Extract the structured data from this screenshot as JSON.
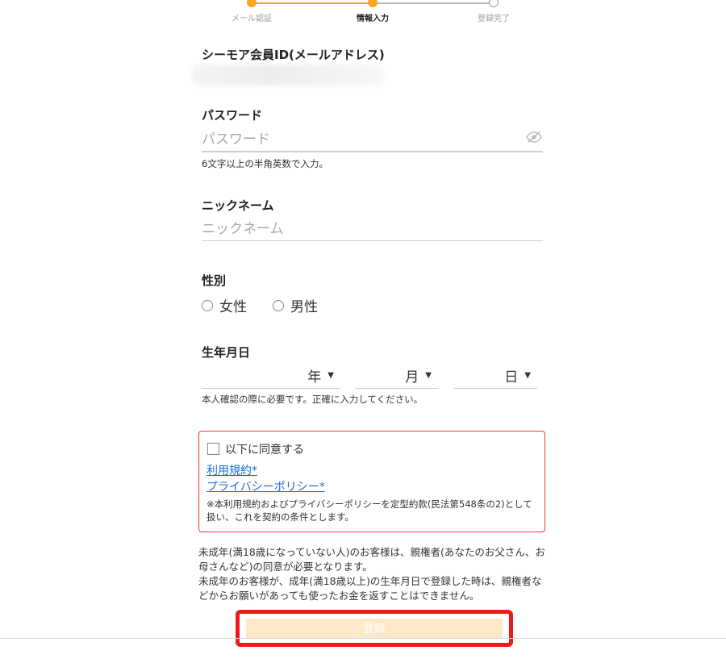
{
  "stepper": {
    "steps": [
      {
        "label": "メール認証"
      },
      {
        "label": "情報入力"
      },
      {
        "label": "登録完了"
      }
    ],
    "accent_color": "#f5a623"
  },
  "email": {
    "title": "シーモア会員ID(メールアドレス)"
  },
  "password": {
    "title": "パスワード",
    "placeholder": "パスワード",
    "value": "",
    "hint": "6文字以上の半角英数で入力。",
    "toggle_icon": "eye-off-icon"
  },
  "nickname": {
    "title": "ニックネーム",
    "placeholder": "ニックネーム",
    "value": ""
  },
  "gender": {
    "title": "性別",
    "options": [
      "女性",
      "男性"
    ]
  },
  "birthdate": {
    "title": "生年月日",
    "year_label": "年",
    "month_label": "月",
    "day_label": "日",
    "hint": "本人確認の際に必要です。正確に入力してください。"
  },
  "agreement": {
    "label": "以下に同意する",
    "terms_link": "利用規約*",
    "privacy_link": "プライバシーポリシー*",
    "note": "※本利用規約およびプライバシーポリシーを定型約款(民法第548条の2)として扱い、これを契約の条件とします。",
    "border_color": "#e03a3a"
  },
  "minor_note": {
    "line1": "未成年(満18歳になっていない人)のお客様は、親権者(あなたのお父さん、お母さんなど)の同意が必要となります。",
    "line2": "未成年のお客様が、成年(満18歳以上)の生年月日で登録した時は、親権者などからお願いがあっても使ったお金を返すことはできません。"
  },
  "submit": {
    "label": "登録",
    "bg_color": "#fde8c8",
    "highlight_color": "#ee1a1a"
  }
}
